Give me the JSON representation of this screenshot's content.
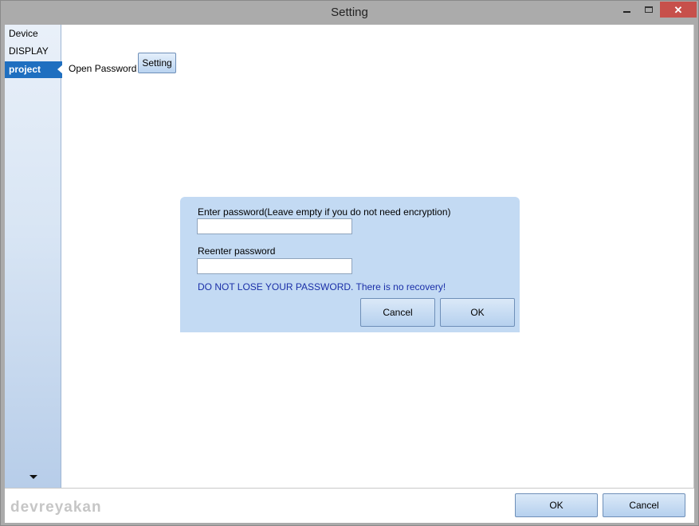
{
  "window": {
    "title": "Setting"
  },
  "sidebar": {
    "items": [
      {
        "label": "Device",
        "selected": false
      },
      {
        "label": "DISPLAY",
        "selected": false
      },
      {
        "label": "project",
        "selected": true
      }
    ]
  },
  "main": {
    "open_password_label": "Open Password",
    "setting_button": "Setting"
  },
  "dialog": {
    "password_label": "Enter password(Leave empty if you do not need encryption)",
    "password_value": "",
    "reenter_label": "Reenter password",
    "reenter_value": "",
    "warning": "DO NOT LOSE YOUR PASSWORD. There is no recovery!",
    "cancel_label": "Cancel",
    "ok_label": "OK"
  },
  "footer": {
    "watermark": "devreyakan",
    "ok_label": "OK",
    "cancel_label": "Cancel"
  },
  "colors": {
    "selection": "#1f6fc0",
    "dialog_bg": "#c3daf3",
    "close_button": "#c7504b",
    "warning_text": "#1a2fa8"
  }
}
